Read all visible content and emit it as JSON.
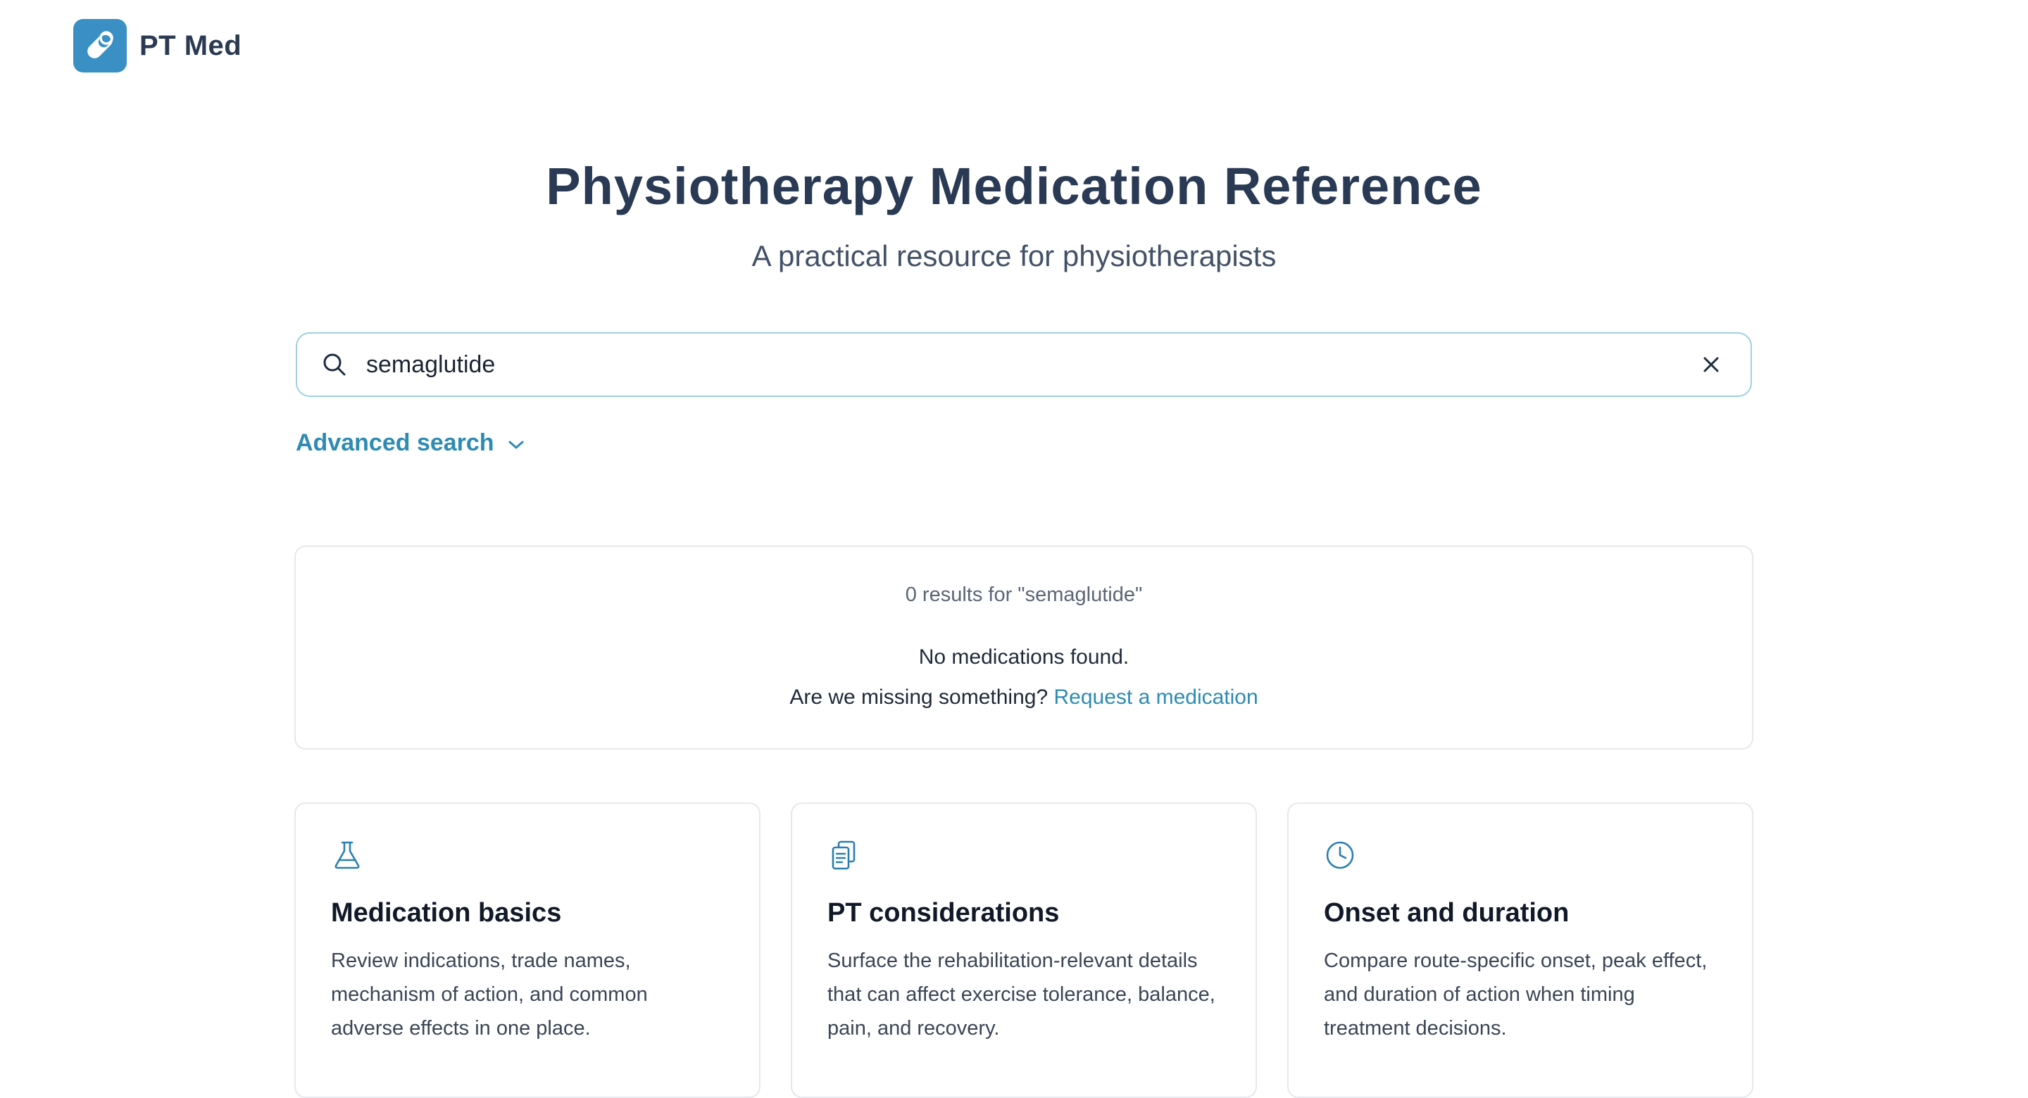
{
  "header": {
    "brand": "PT Med",
    "logo_icon": "pill-icon",
    "logo_color": "#3a90c4"
  },
  "hero": {
    "title": "Physiotherapy Medication Reference",
    "subtitle": "A practical resource for physiotherapists"
  },
  "search": {
    "value": "semaglutide",
    "placeholder": "",
    "icon": "search-icon",
    "clear_icon": "close-icon",
    "border_color": "#9fd0e0"
  },
  "advanced_search": {
    "label": "Advanced search",
    "icon": "chevron-down-icon",
    "color": "#2e8bb3"
  },
  "results": {
    "count_text": "0 results for \"semaglutide\"",
    "empty_text": "No medications found.",
    "missing_text": "Are we missing something?",
    "request_link": "Request a medication"
  },
  "cards": [
    {
      "icon": "flask-icon",
      "title": "Medication basics",
      "body": "Review indications, trade names, mechanism of action, and common adverse effects in one place."
    },
    {
      "icon": "clipboard-icon",
      "title": "PT considerations",
      "body": "Surface the rehabilitation-relevant details that can affect exercise tolerance, balance, pain, and recovery."
    },
    {
      "icon": "clock-icon",
      "title": "Onset and duration",
      "body": "Compare route-specific onset, peak effect, and duration of action when timing treatment decisions."
    }
  ]
}
